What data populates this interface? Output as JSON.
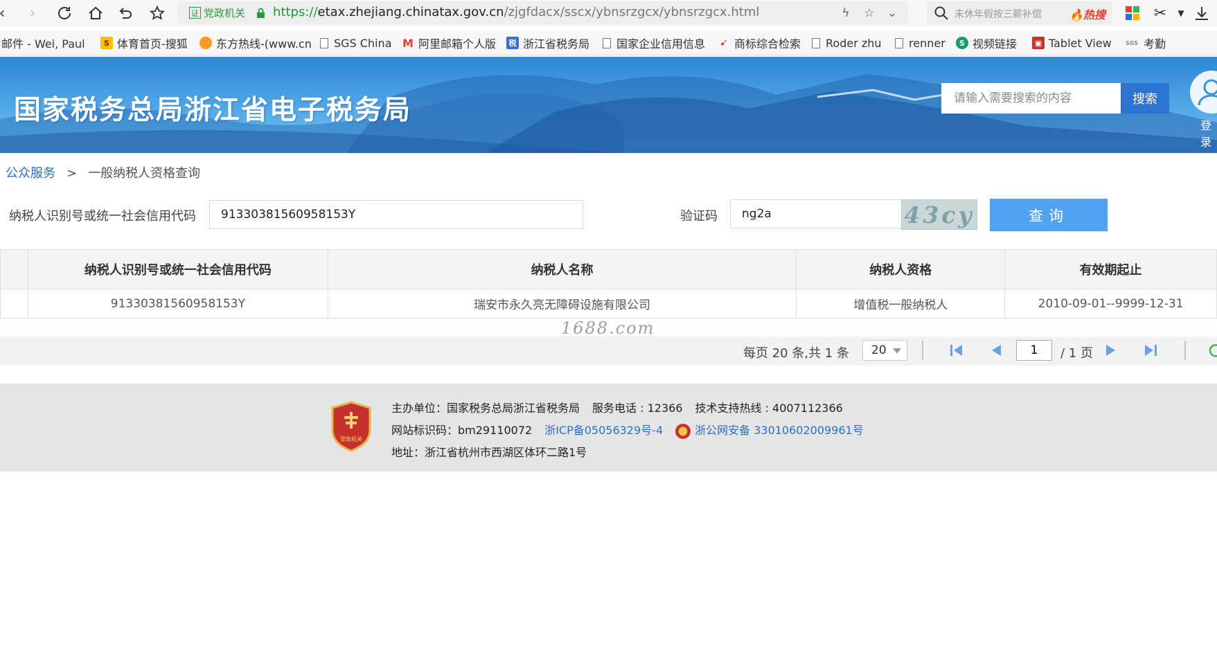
{
  "browser": {
    "gov_badge": "党政机关",
    "gov_badge_icon": "证",
    "url_scheme": "https://",
    "url_host": "etax.zhejiang.chinatax.gov.cn",
    "url_path": "/zjgfdacx/sscx/ybnsrzgcx/ybnsrzgcx.html",
    "search_placeholder": "未休年假按三薪补偿",
    "search_hot": "热搜"
  },
  "bookmarks": [
    {
      "label": "邮件 - Wei, Paul",
      "icon": "mail-icon"
    },
    {
      "label": "体育首页-搜狐",
      "icon": "sohu-icon",
      "icon_text": "S"
    },
    {
      "label": "东方热线-(www.cn",
      "icon": "cnool-icon"
    },
    {
      "label": "SGS China",
      "icon": "page-icon"
    },
    {
      "label": "阿里邮箱个人版",
      "icon": "aliyun-mail-icon",
      "icon_text": "M"
    },
    {
      "label": "浙江省税务局",
      "icon": "tax-icon",
      "icon_text": "税"
    },
    {
      "label": "国家企业信用信息",
      "icon": "page-icon"
    },
    {
      "label": "商标综合检索",
      "icon": "trademark-icon"
    },
    {
      "label": "Roder zhu",
      "icon": "page-icon"
    },
    {
      "label": "renner",
      "icon": "page-icon"
    },
    {
      "label": "视频链接",
      "icon": "video-icon",
      "icon_text": "S"
    },
    {
      "label": "Tablet View",
      "icon": "tablet-icon"
    },
    {
      "label": "考勤",
      "icon": "sgs-icon",
      "icon_text": "SGS"
    }
  ],
  "banner": {
    "title": "国家税务总局浙江省电子税务局",
    "search_placeholder": "请输入需要搜索的内容",
    "search_button": "搜索",
    "login_label": "登录"
  },
  "breadcrumb": {
    "root": "公众服务",
    "separator": ">",
    "current": "一般纳税人资格查询"
  },
  "form": {
    "id_label": "纳税人识别号或统一社会信用代码",
    "id_value": "91330381560958153Y",
    "captcha_label": "验证码",
    "captcha_value": "ng2a",
    "captcha_image_text": "43cy",
    "query_button": "查询"
  },
  "table": {
    "headers": [
      "",
      "纳税人识别号或统一社会信用代码",
      "纳税人名称",
      "纳税人资格",
      "有效期起止"
    ],
    "rows": [
      [
        "",
        "91330381560958153Y",
        "瑞安市永久亮无障碍设施有限公司",
        "增值税一般纳税人",
        "2010-09-01--9999-12-31"
      ]
    ]
  },
  "watermark": "1688.com",
  "pager": {
    "info": "每页 20 条,共 1 条",
    "page_size": "20",
    "current_page": "1",
    "total": "/ 1 页"
  },
  "footer": {
    "logo_caption": "党政机关",
    "sponsor": "主办单位：国家税务总局浙江省税务局",
    "phone": "服务电话 : 12366",
    "support": "技术支持热线 : 4007112366",
    "site_id": "网站标识码：bm29110072",
    "icp": "浙ICP备05056329号-4",
    "police": "浙公网安备 33010602009961号",
    "address": "地址：浙江省杭州市西湖区体环二路1号"
  },
  "colors": {
    "banner_blue": "#3a93dd",
    "link_blue": "#2d6fc6",
    "query_button": "#50a3ef",
    "search_button": "#2d73d1"
  }
}
